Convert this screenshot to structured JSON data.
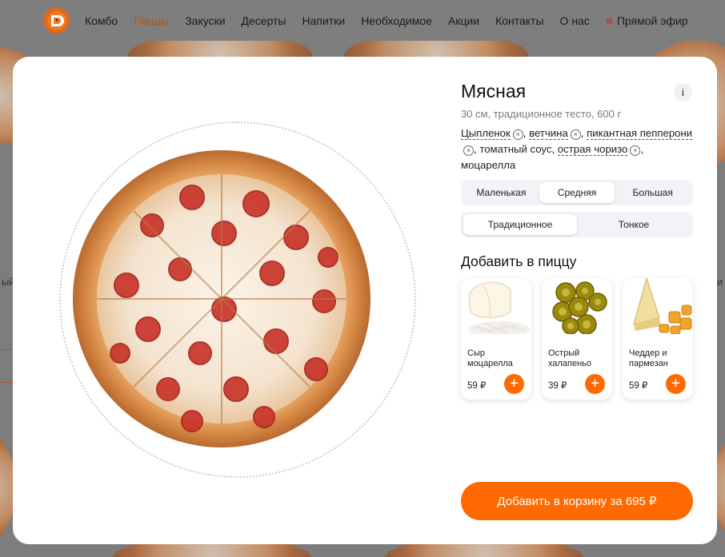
{
  "header": {
    "nav": [
      {
        "label": "Комбо",
        "active": false
      },
      {
        "label": "Пиццы",
        "active": true
      },
      {
        "label": "Закуски",
        "active": false
      },
      {
        "label": "Десерты",
        "active": false
      },
      {
        "label": "Напитки",
        "active": false
      },
      {
        "label": "Необходимое",
        "active": false
      },
      {
        "label": "Акции",
        "active": false
      },
      {
        "label": "Контакты",
        "active": false
      },
      {
        "label": "О нас",
        "active": false
      }
    ],
    "live_label": "Прямой эфир"
  },
  "product": {
    "title": "Мясная",
    "subtitle": "30 см, традиционное тесто, 600 г",
    "ingredients": {
      "chicken": "Цыпленок",
      "ham": "ветчина",
      "pepperoni": "пикантная пепперони",
      "sauce": "томатный соус",
      "chorizo": "острая чоризо",
      "mozzarella": "моцарелла"
    },
    "info_label": "i"
  },
  "size_options": [
    {
      "label": "Маленькая",
      "active": false
    },
    {
      "label": "Средняя",
      "active": true
    },
    {
      "label": "Большая",
      "active": false
    }
  ],
  "dough_options": [
    {
      "label": "Традиционное",
      "active": true
    },
    {
      "label": "Тонкое",
      "active": false
    }
  ],
  "add_heading": "Добавить в пиццу",
  "toppings": [
    {
      "name": "Сыр моцарелла",
      "price": "59 ₽",
      "icon": "mozzarella-icon"
    },
    {
      "name": "Острый халапеньо",
      "price": "39 ₽",
      "icon": "jalapeno-icon"
    },
    {
      "name": "Чеддер и пармезан",
      "price": "59 ₽",
      "icon": "cheddar-parmesan-icon"
    }
  ],
  "cart_button": "Добавить в корзину за 695 ₽",
  "background": {
    "side_text_left": "ый",
    "side_text_right": "и"
  },
  "colors": {
    "accent": "#ff6900",
    "nav_active": "#b8560f",
    "overlay": "#7d7d7d"
  }
}
